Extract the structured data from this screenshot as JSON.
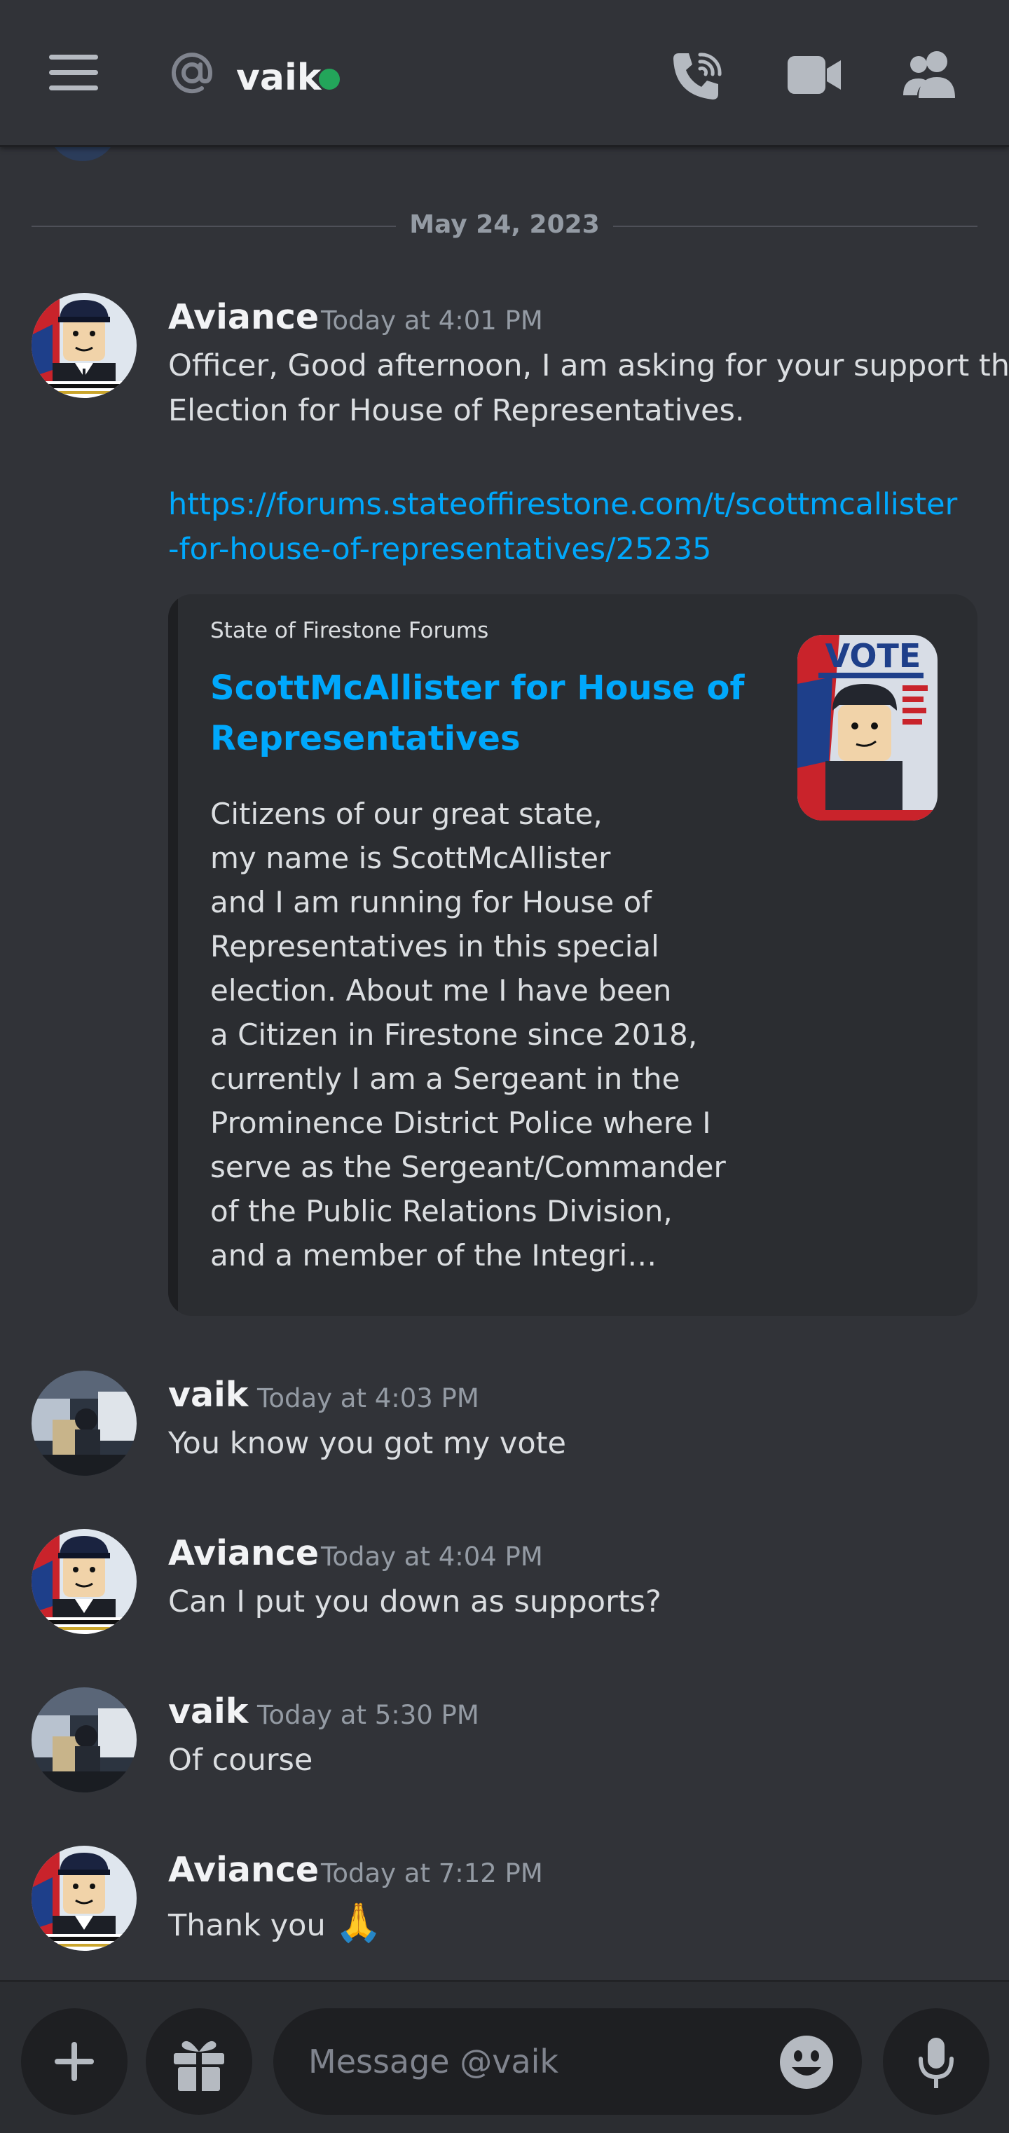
{
  "header": {
    "dm_name": "vaik",
    "status_color": "#23a55a"
  },
  "divider": {
    "date": "May 24, 2023"
  },
  "messages": [
    {
      "author": "Aviance",
      "time": "Today at 4:01 PM",
      "lines": [
        "Officer, Good afternoon, I am asking for your support this",
        "Election for House of Representatives."
      ],
      "link_lines": [
        "https://forums.stateoffirestone.com/t/scottmcallister",
        "-for-house-of-representatives/25235"
      ],
      "embed": {
        "provider": "State of Firestone Forums",
        "title": "ScottMcAllister for House of Representatives",
        "description": "Citizens of our great state,\nmy name is ScottMcAllister\nand I am running for House of\nRepresentatives in this special\nelection.  About me  I have been\na Citizen in Firestone since 2018,\ncurrently I am a Sergeant in the\nProminence District Police where I\nserve as the Sergeant/Commander\nof the Public Relations Division,\nand a member of the Integri…",
        "thumbnail_text": "VOTE"
      }
    },
    {
      "author": "vaik",
      "time": "Today at 4:03 PM",
      "text": "You know you got my vote"
    },
    {
      "author": "Aviance",
      "time": "Today at 4:04 PM",
      "text": "Can I put you down as supports?"
    },
    {
      "author": "vaik",
      "time": "Today at 5:30 PM",
      "text": "Of course"
    },
    {
      "author": "Aviance",
      "time": "Today at 7:12 PM",
      "text": "Thank you",
      "emoji": "🙏"
    }
  ],
  "composer": {
    "placeholder": "Message @vaik"
  },
  "colors": {
    "background": "#313338",
    "link": "#00a8fc",
    "muted": "#949ba4"
  },
  "icons": [
    "menu-icon",
    "at-sign-icon",
    "phone-call-icon",
    "video-camera-icon",
    "members-icon",
    "plus-icon",
    "gift-icon",
    "emoji-icon",
    "microphone-icon"
  ]
}
